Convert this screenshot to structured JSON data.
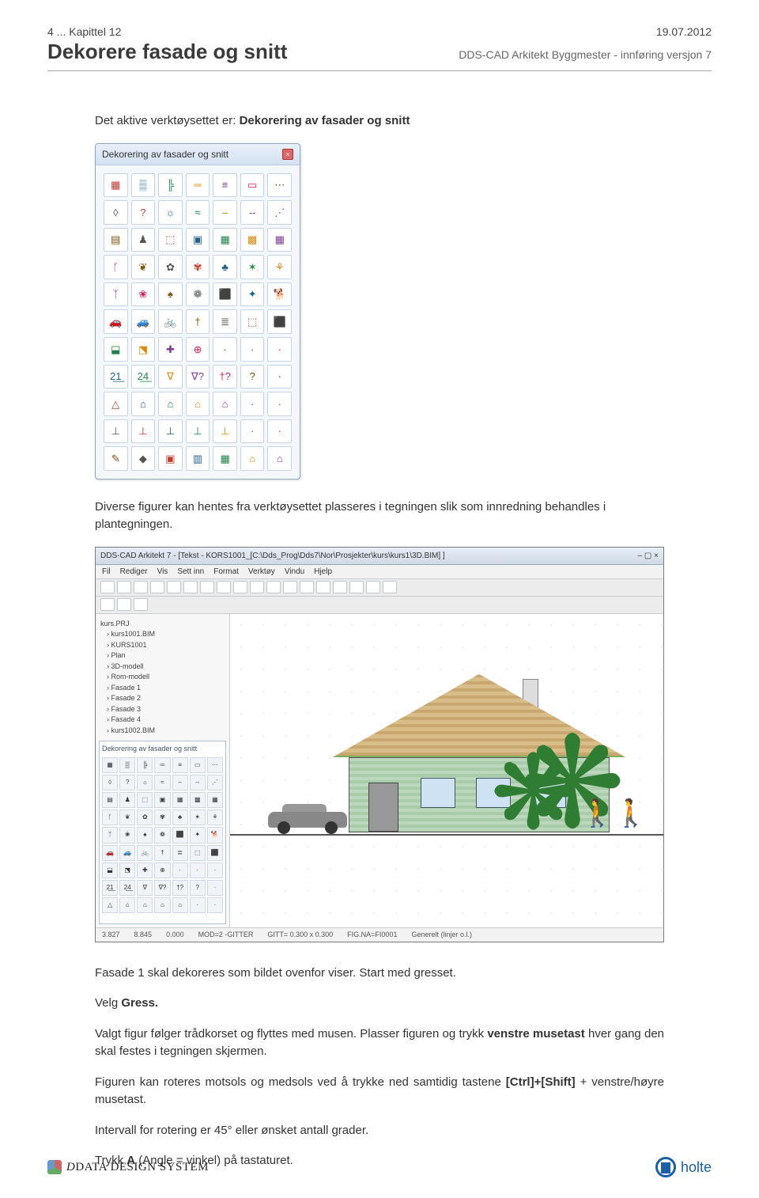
{
  "header": {
    "chapter": "4 ... Kapittel 12",
    "date": "19.07.2012",
    "title": "Dekorere fasade og snitt",
    "subtitle": "DDS-CAD Arkitekt Byggmester - innføring versjon 7"
  },
  "body": {
    "p1_prefix": "Det aktive verktøysettet er: ",
    "p1_bold": "Dekorering av fasader og snitt",
    "p2": "Diverse figurer kan hentes fra verktøysettet plasseres i tegningen slik som innredning behandles i plantegningen.",
    "p3": "Fasade 1 skal dekoreres som bildet ovenfor viser. Start med gresset.",
    "p4_prefix": "Velg ",
    "p4_bold": "Gress.",
    "p5_prefix": "Valgt figur følger trådkorset og flyttes med musen. Plasser figuren og trykk ",
    "p5_bold": "venstre musetast",
    "p5_suffix": " hver gang den skal festes i tegningen skjermen.",
    "p6_prefix": "Figuren kan roteres motsols og medsols ved å trykke ned samtidig tastene ",
    "p6_bold": "[Ctrl]+[Shift]",
    "p6_suffix": " + venstre/høyre musetast.",
    "p7": "Intervall for rotering er 45° eller ønsket antall grader.",
    "p8_prefix": "Trykk ",
    "p8_bold": "A",
    "p8_suffix": " (Angle = vinkel) på tastaturet."
  },
  "palette": {
    "title": "Dekorering av fasader og snitt",
    "cells": [
      "▦",
      "▒",
      "╠",
      "═",
      "≡",
      "▭",
      "⋯",
      "◊",
      "?",
      "☼",
      "≈",
      "‒",
      "--",
      "⋰",
      "▤",
      "♟",
      "⬚",
      "▣",
      "▦",
      "▩",
      "▦",
      "ᚴ",
      "❦",
      "✿",
      "✾",
      "♣",
      "✶",
      "⚘",
      "ᛉ",
      "❀",
      "♠",
      "❁",
      "⬛",
      "✦",
      "🐕",
      "🚗",
      "🚙",
      "🚲",
      "†",
      "≣",
      "⬚",
      "⬛",
      "⬓",
      "⬔",
      "✚",
      "⊕",
      "·",
      "·",
      "·",
      "2̲1̲",
      "2̲4̲",
      "∇",
      "∇?",
      "†?",
      "?",
      "·",
      "△",
      "⌂",
      "⌂",
      "⌂",
      "⌂",
      "·",
      "·",
      "⊥",
      "⊥",
      "⊥",
      "⊥",
      "⊥",
      "·",
      "·",
      "✎",
      "◆",
      "▣",
      "▥",
      "▦",
      "⌂",
      "⌂"
    ]
  },
  "workspace": {
    "titlebar": "DDS-CAD Arkitekt 7 - [Tekst - KORS1001_[C:\\Dds_Prog\\Dds7\\Nor\\Prosjekter\\kurs\\kurs1\\3D.BIM] ]",
    "menu": [
      "Fil",
      "Rediger",
      "Vis",
      "Sett inn",
      "Format",
      "Verktøy",
      "Vindu",
      "Hjelp"
    ],
    "tree": {
      "root": "kurs.PRJ",
      "items": [
        "kurs1001.BIM",
        "KURS1001",
        "Plan",
        "3D-modell",
        "Rom-modell",
        "Fasade 1",
        "Fasade 2",
        "Fasade 3",
        "Fasade 4",
        "kurs1002.BIM"
      ]
    },
    "mini_palette_title": "Dekorering av fasader og snitt",
    "status": [
      "3.827",
      "8.845",
      "0.000",
      "MOD=2 -GITTER",
      "GITT= 0.300 x 0.300",
      "FIG.NA=FI0001",
      "Generelt (linjer o.l.)"
    ]
  },
  "footer": {
    "left_brand": "DATA DESIGN SYSTEM",
    "right_brand": "holte"
  }
}
